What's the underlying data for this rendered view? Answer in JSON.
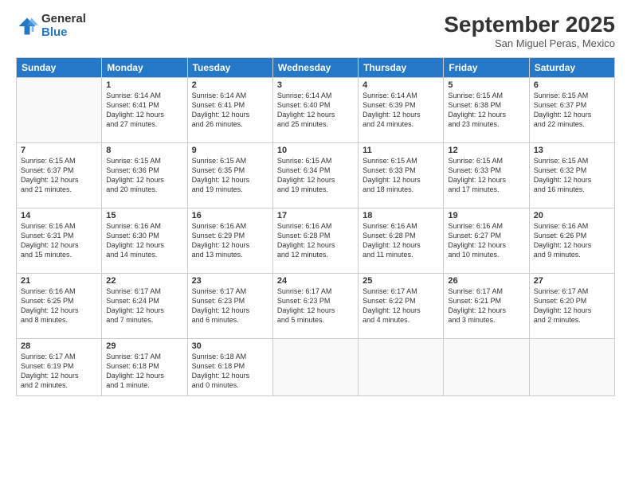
{
  "header": {
    "logo_general": "General",
    "logo_blue": "Blue",
    "month_title": "September 2025",
    "subtitle": "San Miguel Peras, Mexico"
  },
  "days_of_week": [
    "Sunday",
    "Monday",
    "Tuesday",
    "Wednesday",
    "Thursday",
    "Friday",
    "Saturday"
  ],
  "weeks": [
    [
      {
        "day": "",
        "info": ""
      },
      {
        "day": "1",
        "info": "Sunrise: 6:14 AM\nSunset: 6:41 PM\nDaylight: 12 hours\nand 27 minutes."
      },
      {
        "day": "2",
        "info": "Sunrise: 6:14 AM\nSunset: 6:41 PM\nDaylight: 12 hours\nand 26 minutes."
      },
      {
        "day": "3",
        "info": "Sunrise: 6:14 AM\nSunset: 6:40 PM\nDaylight: 12 hours\nand 25 minutes."
      },
      {
        "day": "4",
        "info": "Sunrise: 6:14 AM\nSunset: 6:39 PM\nDaylight: 12 hours\nand 24 minutes."
      },
      {
        "day": "5",
        "info": "Sunrise: 6:15 AM\nSunset: 6:38 PM\nDaylight: 12 hours\nand 23 minutes."
      },
      {
        "day": "6",
        "info": "Sunrise: 6:15 AM\nSunset: 6:37 PM\nDaylight: 12 hours\nand 22 minutes."
      }
    ],
    [
      {
        "day": "7",
        "info": "Sunrise: 6:15 AM\nSunset: 6:37 PM\nDaylight: 12 hours\nand 21 minutes."
      },
      {
        "day": "8",
        "info": "Sunrise: 6:15 AM\nSunset: 6:36 PM\nDaylight: 12 hours\nand 20 minutes."
      },
      {
        "day": "9",
        "info": "Sunrise: 6:15 AM\nSunset: 6:35 PM\nDaylight: 12 hours\nand 19 minutes."
      },
      {
        "day": "10",
        "info": "Sunrise: 6:15 AM\nSunset: 6:34 PM\nDaylight: 12 hours\nand 19 minutes."
      },
      {
        "day": "11",
        "info": "Sunrise: 6:15 AM\nSunset: 6:33 PM\nDaylight: 12 hours\nand 18 minutes."
      },
      {
        "day": "12",
        "info": "Sunrise: 6:15 AM\nSunset: 6:33 PM\nDaylight: 12 hours\nand 17 minutes."
      },
      {
        "day": "13",
        "info": "Sunrise: 6:15 AM\nSunset: 6:32 PM\nDaylight: 12 hours\nand 16 minutes."
      }
    ],
    [
      {
        "day": "14",
        "info": "Sunrise: 6:16 AM\nSunset: 6:31 PM\nDaylight: 12 hours\nand 15 minutes."
      },
      {
        "day": "15",
        "info": "Sunrise: 6:16 AM\nSunset: 6:30 PM\nDaylight: 12 hours\nand 14 minutes."
      },
      {
        "day": "16",
        "info": "Sunrise: 6:16 AM\nSunset: 6:29 PM\nDaylight: 12 hours\nand 13 minutes."
      },
      {
        "day": "17",
        "info": "Sunrise: 6:16 AM\nSunset: 6:28 PM\nDaylight: 12 hours\nand 12 minutes."
      },
      {
        "day": "18",
        "info": "Sunrise: 6:16 AM\nSunset: 6:28 PM\nDaylight: 12 hours\nand 11 minutes."
      },
      {
        "day": "19",
        "info": "Sunrise: 6:16 AM\nSunset: 6:27 PM\nDaylight: 12 hours\nand 10 minutes."
      },
      {
        "day": "20",
        "info": "Sunrise: 6:16 AM\nSunset: 6:26 PM\nDaylight: 12 hours\nand 9 minutes."
      }
    ],
    [
      {
        "day": "21",
        "info": "Sunrise: 6:16 AM\nSunset: 6:25 PM\nDaylight: 12 hours\nand 8 minutes."
      },
      {
        "day": "22",
        "info": "Sunrise: 6:17 AM\nSunset: 6:24 PM\nDaylight: 12 hours\nand 7 minutes."
      },
      {
        "day": "23",
        "info": "Sunrise: 6:17 AM\nSunset: 6:23 PM\nDaylight: 12 hours\nand 6 minutes."
      },
      {
        "day": "24",
        "info": "Sunrise: 6:17 AM\nSunset: 6:23 PM\nDaylight: 12 hours\nand 5 minutes."
      },
      {
        "day": "25",
        "info": "Sunrise: 6:17 AM\nSunset: 6:22 PM\nDaylight: 12 hours\nand 4 minutes."
      },
      {
        "day": "26",
        "info": "Sunrise: 6:17 AM\nSunset: 6:21 PM\nDaylight: 12 hours\nand 3 minutes."
      },
      {
        "day": "27",
        "info": "Sunrise: 6:17 AM\nSunset: 6:20 PM\nDaylight: 12 hours\nand 2 minutes."
      }
    ],
    [
      {
        "day": "28",
        "info": "Sunrise: 6:17 AM\nSunset: 6:19 PM\nDaylight: 12 hours\nand 2 minutes."
      },
      {
        "day": "29",
        "info": "Sunrise: 6:17 AM\nSunset: 6:18 PM\nDaylight: 12 hours\nand 1 minute."
      },
      {
        "day": "30",
        "info": "Sunrise: 6:18 AM\nSunset: 6:18 PM\nDaylight: 12 hours\nand 0 minutes."
      },
      {
        "day": "",
        "info": ""
      },
      {
        "day": "",
        "info": ""
      },
      {
        "day": "",
        "info": ""
      },
      {
        "day": "",
        "info": ""
      }
    ]
  ]
}
